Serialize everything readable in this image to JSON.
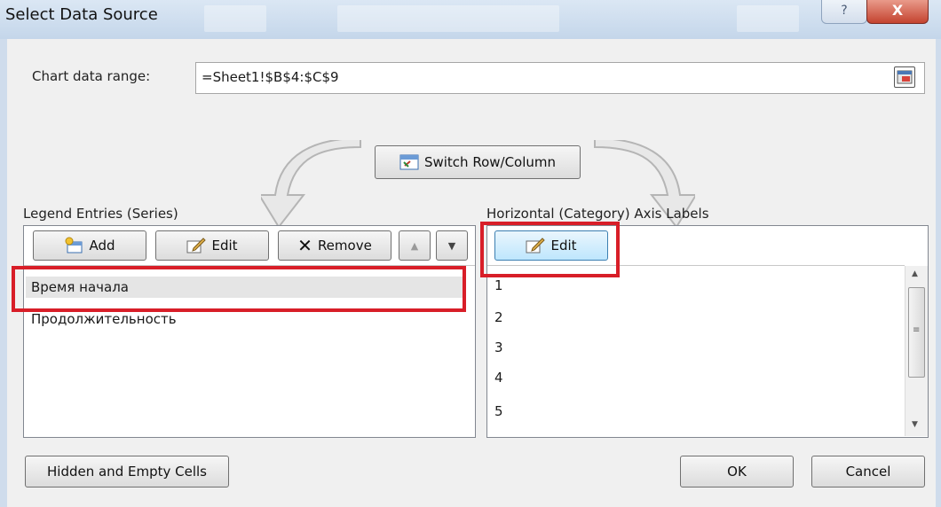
{
  "dialog": {
    "title": "Select Data Source",
    "help_glyph": "?",
    "close_glyph": "X"
  },
  "range": {
    "label": "Chart data range:",
    "value": "=Sheet1!$B$4:$C$9"
  },
  "switch_button": {
    "label": "Switch Row/Column"
  },
  "legend": {
    "title": "Legend Entries (Series)",
    "add_label": "Add",
    "edit_label": "Edit",
    "remove_label": "Remove",
    "items": [
      "Время начала",
      "Продолжительность"
    ],
    "selected_index": 0
  },
  "axis": {
    "title": "Horizontal (Category) Axis Labels",
    "edit_label": "Edit",
    "items": [
      "1",
      "2",
      "3",
      "4",
      "5"
    ]
  },
  "footer": {
    "hidden_cells_label": "Hidden and Empty Cells",
    "ok_label": "OK",
    "cancel_label": "Cancel"
  },
  "colors": {
    "highlight": "#d81e28",
    "window_face": "#f0f0f0",
    "title_bar": "#c4d6ea"
  },
  "icons": {
    "range_picker": "range-collapse-icon",
    "switch": "switch-table-icon",
    "add": "add-series-icon",
    "edit": "pencil-edit-icon",
    "remove": "x-remove-icon",
    "move_up": "triangle-up-icon",
    "move_down": "triangle-down-icon"
  }
}
